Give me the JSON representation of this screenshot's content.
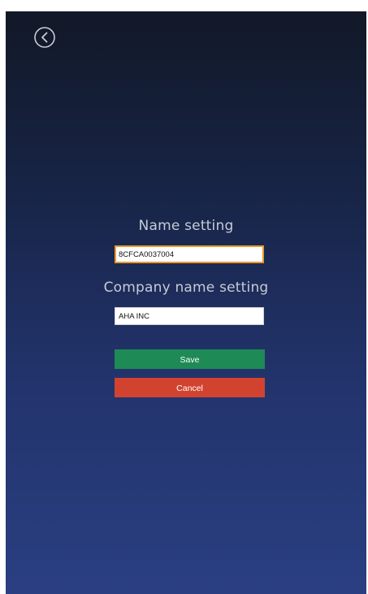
{
  "nav": {
    "back_icon": "back-arrow-circle-icon"
  },
  "name_section": {
    "heading": "Name setting",
    "value": "8CFCA0037004"
  },
  "company_section": {
    "heading": "Company name setting",
    "value": "AHA INC"
  },
  "actions": {
    "save_label": "Save",
    "cancel_label": "Cancel"
  },
  "colors": {
    "save": "#1e8a56",
    "cancel": "#d2432f",
    "focus_border": "#e89a2b",
    "heading_text": "#c7cbd6"
  }
}
